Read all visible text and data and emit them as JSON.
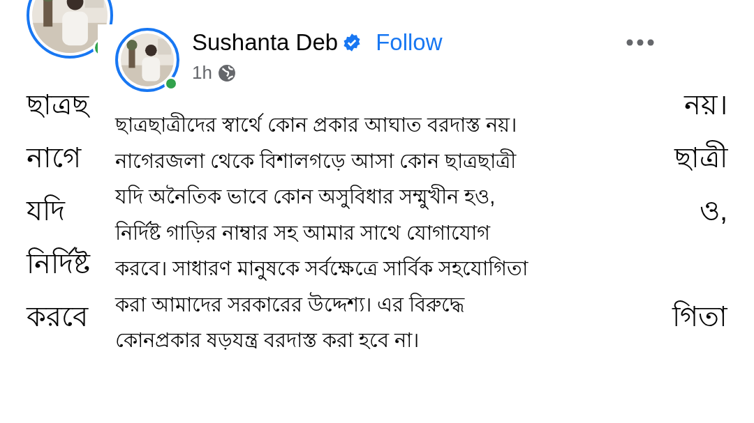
{
  "background_post": {
    "online": true,
    "fragments": [
      {
        "left": "ছাত্রছ",
        "right": "নয়।"
      },
      {
        "left": "নাগে",
        "right": "ছাত্রী"
      },
      {
        "left": "যদি",
        "right": "ও,"
      },
      {
        "left": "নির্দিষ্ট"
      },
      {
        "left": "করবে",
        "right": "গিতা"
      }
    ]
  },
  "post": {
    "author": "Sushanta Deb",
    "verified": true,
    "follow": "Follow",
    "time": "1h",
    "online": true,
    "body": "ছাত্রছাত্রীদের স্বার্থে কোন প্রকার আঘাত বরদাস্ত নয়।\nনাগেরজলা থেকে বিশালগড়ে আসা কোন ছাত্রছাত্রী\nযদি অনৈতিক ভাবে কোন অসুবিধার সম্মুখীন হও,\nনির্দিষ্ট গাড়ির নাম্বার সহ আমার সাথে যোগাযোগ\nকরবে। সাধারণ মানুষকে সর্বক্ষেত্রে সার্বিক সহযোগিতা\nকরা আমাদের সরকারের উদ্দেশ্য। এর বিরুদ্ধে\nকোনপ্রকার ষড়যন্ত্র বরদাস্ত করা হবে না।"
  }
}
